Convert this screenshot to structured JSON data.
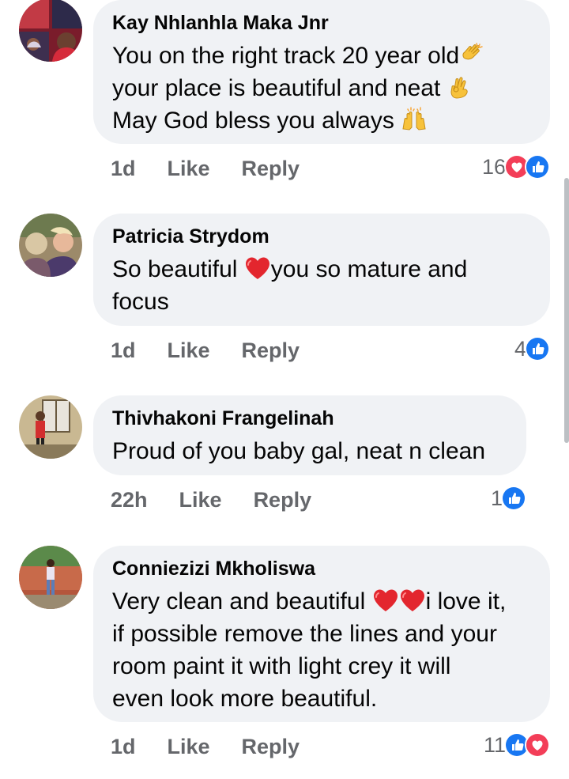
{
  "colors": {
    "bubble": "#f0f2f5",
    "meta_text": "#65676b",
    "like_blue": "#1877f2",
    "love_red": "#f33e58"
  },
  "comments": [
    {
      "author": "Kay Nhlanhla Maka Jnr",
      "lines": [
        "You on the right track 20 year old",
        "your place is beautiful and neat ",
        "May God bless you always "
      ],
      "emojis": [
        "clapping-hands",
        "ok-hand",
        "raising-hands"
      ],
      "time": "1d",
      "like_label": "Like",
      "reply_label": "Reply",
      "reaction_count": "16",
      "reactions": [
        "love",
        "like"
      ]
    },
    {
      "author": "Patricia Strydom",
      "lines": [
        "So beautiful ",
        "you so mature and",
        "focus"
      ],
      "emojis": [
        "red-heart"
      ],
      "time": "1d",
      "like_label": "Like",
      "reply_label": "Reply",
      "reaction_count": "4",
      "reactions": [
        "like"
      ]
    },
    {
      "author": "Thivhakoni Frangelinah",
      "lines": [
        "Proud of you baby gal, neat n clean"
      ],
      "time": "22h",
      "like_label": "Like",
      "reply_label": "Reply",
      "reaction_count": "1",
      "reactions": [
        "like"
      ]
    },
    {
      "author": "Conniezizi Mkholiswa",
      "lines": [
        "Very clean and beautiful ",
        "i love it,",
        "if possible remove the lines and your",
        "room paint it with light crey it will",
        "even look more beautiful."
      ],
      "emojis": [
        "red-heart",
        "red-heart"
      ],
      "time": "1d",
      "like_label": "Like",
      "reply_label": "Reply",
      "reaction_count": "11",
      "reactions": [
        "like",
        "love"
      ]
    }
  ]
}
